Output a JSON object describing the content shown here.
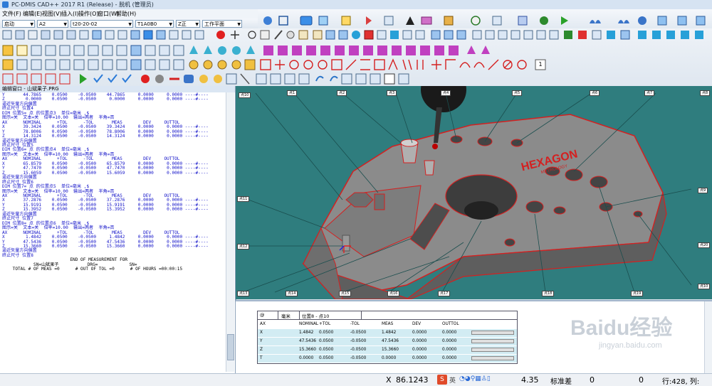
{
  "window": {
    "title": "PC-DMIS CAD++ 2017 R1 (Release) - 脱机 (管理员)"
  },
  "menu": {
    "items": [
      "文件(F)",
      "编辑(E)",
      "视图(V)",
      "插入(I)",
      "操作(O)",
      "窗口(W)",
      "帮助(H)"
    ]
  },
  "toolbar": {
    "selects": [
      {
        "name": "mode-select",
        "value": "启动"
      },
      {
        "name": "probe-select",
        "value": "A2"
      },
      {
        "name": "tip-select",
        "value": "T1A0B0"
      },
      {
        "name": "angle-select",
        "value": "T1A0B0"
      },
      {
        "name": "plane-axis-select",
        "value": "Z正"
      },
      {
        "name": "workplane-select",
        "value": "工作平面"
      }
    ],
    "tip_select_value": "t20-20-02",
    "number_box": "1"
  },
  "edit_window": {
    "title": "编辑窗口 - 山斌果子.PRG",
    "lines": [
      "Y       44.7865    0.0500    -0.0500    44.7865     0.0000     0.0000 ----#----",
      "Z        0.0000    0.0500    -0.0500     0.0000     0.0000     0.0000 ----#----",
      "逼近矢量方向偏置",
      "终止尺寸 位置4",
      "DIM 位置5= 点 的位置点3  单位=毫米 ,$",
      "图示=关  文本=关  倍率=10.00  输出=两者  半角=否",
      "AX      NOMINAL      +TOL      -TOL       MEAS        DEV     OUTTOL",
      "X       39.3424    0.0500    -0.0500    39.3424     0.0000     0.0000 ----#----",
      "Y       78.8006    0.0500    -0.0500    78.8006     0.0000     0.0000 ----#----",
      "Z       14.3124    0.0500    -0.0500    14.3124     0.0000     0.0000 ----#----",
      "逼近矢量方向偏置",
      "终止尺寸 位置5",
      "DIM 位置6= 点 的位置点4  单位=毫米 ,$",
      "图示=关  文本=关  倍率=10.00  输出=两者  半角=否",
      "AX      NOMINAL      +TOL      -TOL       MEAS        DEV     OUTTOL",
      "X       65.8579    0.0500    -0.0500    65.8579     0.0000     0.0000 ----#----",
      "Y       47.7470    0.0500    -0.0500    47.7470     0.0000     0.0000 ----#----",
      "Z       15.6059    0.0500    -0.0500    15.6059     0.0000     0.0000 ----#----",
      "逼近矢量方向偏置",
      "终止尺寸 位置6",
      "DIM 位置7= 点 的位置点5  单位=毫米 ,$",
      "图示=关  文本=关  倍率=10.00  输出=两者  半角=否",
      "AX      NOMINAL      +TOL      -TOL       MEAS        DEV     OUTTOL",
      "X       37.2876    0.0500    -0.0500    37.2876     0.0000     0.0000 ----#----",
      "Y       15.9191    0.0500    -0.0500    15.9191     0.0000     0.0000 ----#----",
      "Z       15.3952    0.0500    -0.0500    15.3952     0.0000     0.0000 ----#----",
      "逼近矢量方向偏置",
      "终止尺寸 位置7",
      "DIM 位置8= 点 的位置点6  单位=毫米 ,$",
      "图示=关  文本=关  倍率=10.00  输出=两者  半角=否",
      "AX      NOMINAL      +TOL      -TOL       MEAS        DEV     OUTTOL",
      "X        1.4842    0.0500    -0.0500     1.4842     0.0000     0.0000 ----#----",
      "Y       47.5436    0.0500    -0.0500    47.5436     0.0000     0.0000 ----#----",
      "Z       15.3660    0.0500    -0.0500    15.3660     0.0000     0.0000 ----#----",
      "逼近矢量方向偏置",
      "终止尺寸 位置8",
      "",
      "                          END OF MEASUREMENT FOR",
      "            SN=山斌果子           DRG=            SN=",
      "    TOTAL # OF MEAS =0      # OUT OF TOL =0      # OF HOURS =00:00:15"
    ]
  },
  "graphics": {
    "brand": "HEXAGON",
    "brand_sub": "METROLOGY",
    "labels": [
      "点10",
      "点1",
      "点2",
      "点3",
      "点4",
      "点5",
      "点6",
      "点7",
      "点8",
      "点9",
      "点10",
      "点11",
      "点12",
      "点13",
      "点14",
      "点15",
      "点16",
      "点17",
      "点18",
      "点19",
      "点20",
      "点21",
      "点22",
      "点23"
    ]
  },
  "report": {
    "header": {
      "col1": "@",
      "col2": "毫米",
      "col3": "位置8 - 点10"
    },
    "columns": [
      "AX",
      "NOMINAL",
      "+TOL",
      "-TOL",
      "MEAS",
      "DEV",
      "OUTTOL"
    ],
    "rows": [
      [
        "X",
        "1.4842",
        "0.0500",
        "-0.0500",
        "1.4842",
        "0.0000",
        "0.0000"
      ],
      [
        "Y",
        "47.5436",
        "0.0500",
        "-0.0500",
        "47.5436",
        "0.0000",
        "0.0000"
      ],
      [
        "Z",
        "15.3660",
        "0.0500",
        "-0.0500",
        "15.3660",
        "0.0000",
        "0.0000"
      ],
      [
        "T",
        "0.0000",
        "0.0500",
        "-0.0500",
        "0.0000",
        "0.0000",
        "0.0000"
      ]
    ]
  },
  "status": {
    "x_label": "X",
    "x_value": "86.1243",
    "ime": "英",
    "z_value": "4.35",
    "std_dev_label": "标准差",
    "std_dev_value": "0",
    "zero": "0",
    "line_info": "行:428, 列:"
  },
  "watermark": {
    "line1": "Baidu经验",
    "line2": "jingyan.baidu.com"
  },
  "colors": {
    "viewport": "#2f7d7e",
    "edit_blue": "#1010c8",
    "report_alt": "#d2ecf3",
    "part": "#8a8a8a",
    "edge": "#d42020"
  }
}
